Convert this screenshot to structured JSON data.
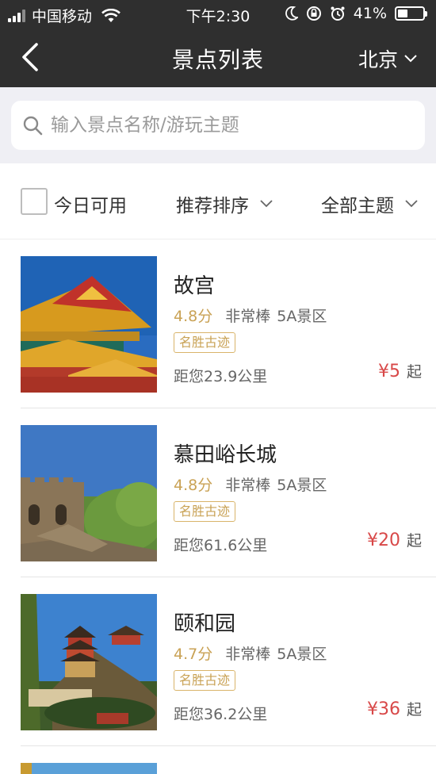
{
  "status_bar": {
    "carrier": "中国移动",
    "time": "下午2:30",
    "battery": "41%"
  },
  "nav": {
    "title": "景点列表",
    "city": "北京"
  },
  "search": {
    "placeholder": "输入景点名称/游玩主题"
  },
  "filters": {
    "today_label": "今日可用",
    "sort_label": "推荐排序",
    "theme_label": "全部主题"
  },
  "spots": [
    {
      "name": "故宫",
      "score": "4.8分",
      "praise": "非常棒",
      "level": "5A景区",
      "tag": "名胜古迹",
      "distance": "距您23.9公里",
      "price": "¥5",
      "price_suffix": "起",
      "image_icon": "forbidden-city-photo"
    },
    {
      "name": "慕田峪长城",
      "score": "4.8分",
      "praise": "非常棒",
      "level": "5A景区",
      "tag": "名胜古迹",
      "distance": "距您61.6公里",
      "price": "¥20",
      "price_suffix": "起",
      "image_icon": "great-wall-photo"
    },
    {
      "name": "颐和园",
      "score": "4.7分",
      "praise": "非常棒",
      "level": "5A景区",
      "tag": "名胜古迹",
      "distance": "距您36.2公里",
      "price": "¥36",
      "price_suffix": "起",
      "image_icon": "summer-palace-photo"
    }
  ],
  "colors": {
    "header_bg": "#2f2f2f",
    "score_gold": "#c9a255",
    "price_red": "#d84848",
    "page_gray": "#efeff4"
  }
}
